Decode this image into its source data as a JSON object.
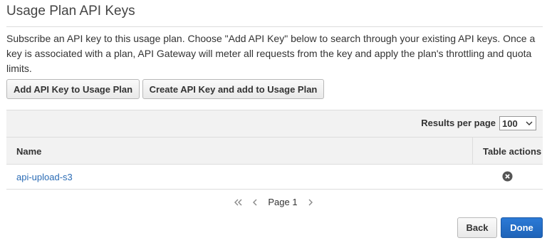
{
  "section": {
    "title": "Usage Plan API Keys",
    "description": "Subscribe an API key to this usage plan. Choose \"Add API Key\" below to search through your existing API keys. Once a key is associated with a plan, API Gateway will meter all requests from the key and apply the plan's throttling and quota limits."
  },
  "actions": {
    "add_key_label": "Add API Key to Usage Plan",
    "create_key_label": "Create API Key and add to Usage Plan"
  },
  "table": {
    "results_per_page_label": "Results per page",
    "results_per_page_value": "100",
    "columns": {
      "name": "Name",
      "actions": "Table actions"
    },
    "rows": [
      {
        "name": "api-upload-s3",
        "action_icon": "remove-circle-icon"
      }
    ]
  },
  "pagination": {
    "page_label": "Page 1"
  },
  "footer": {
    "back_label": "Back",
    "done_label": "Done"
  },
  "colors": {
    "link": "#2b6cb5",
    "primary": "#2074d5"
  }
}
